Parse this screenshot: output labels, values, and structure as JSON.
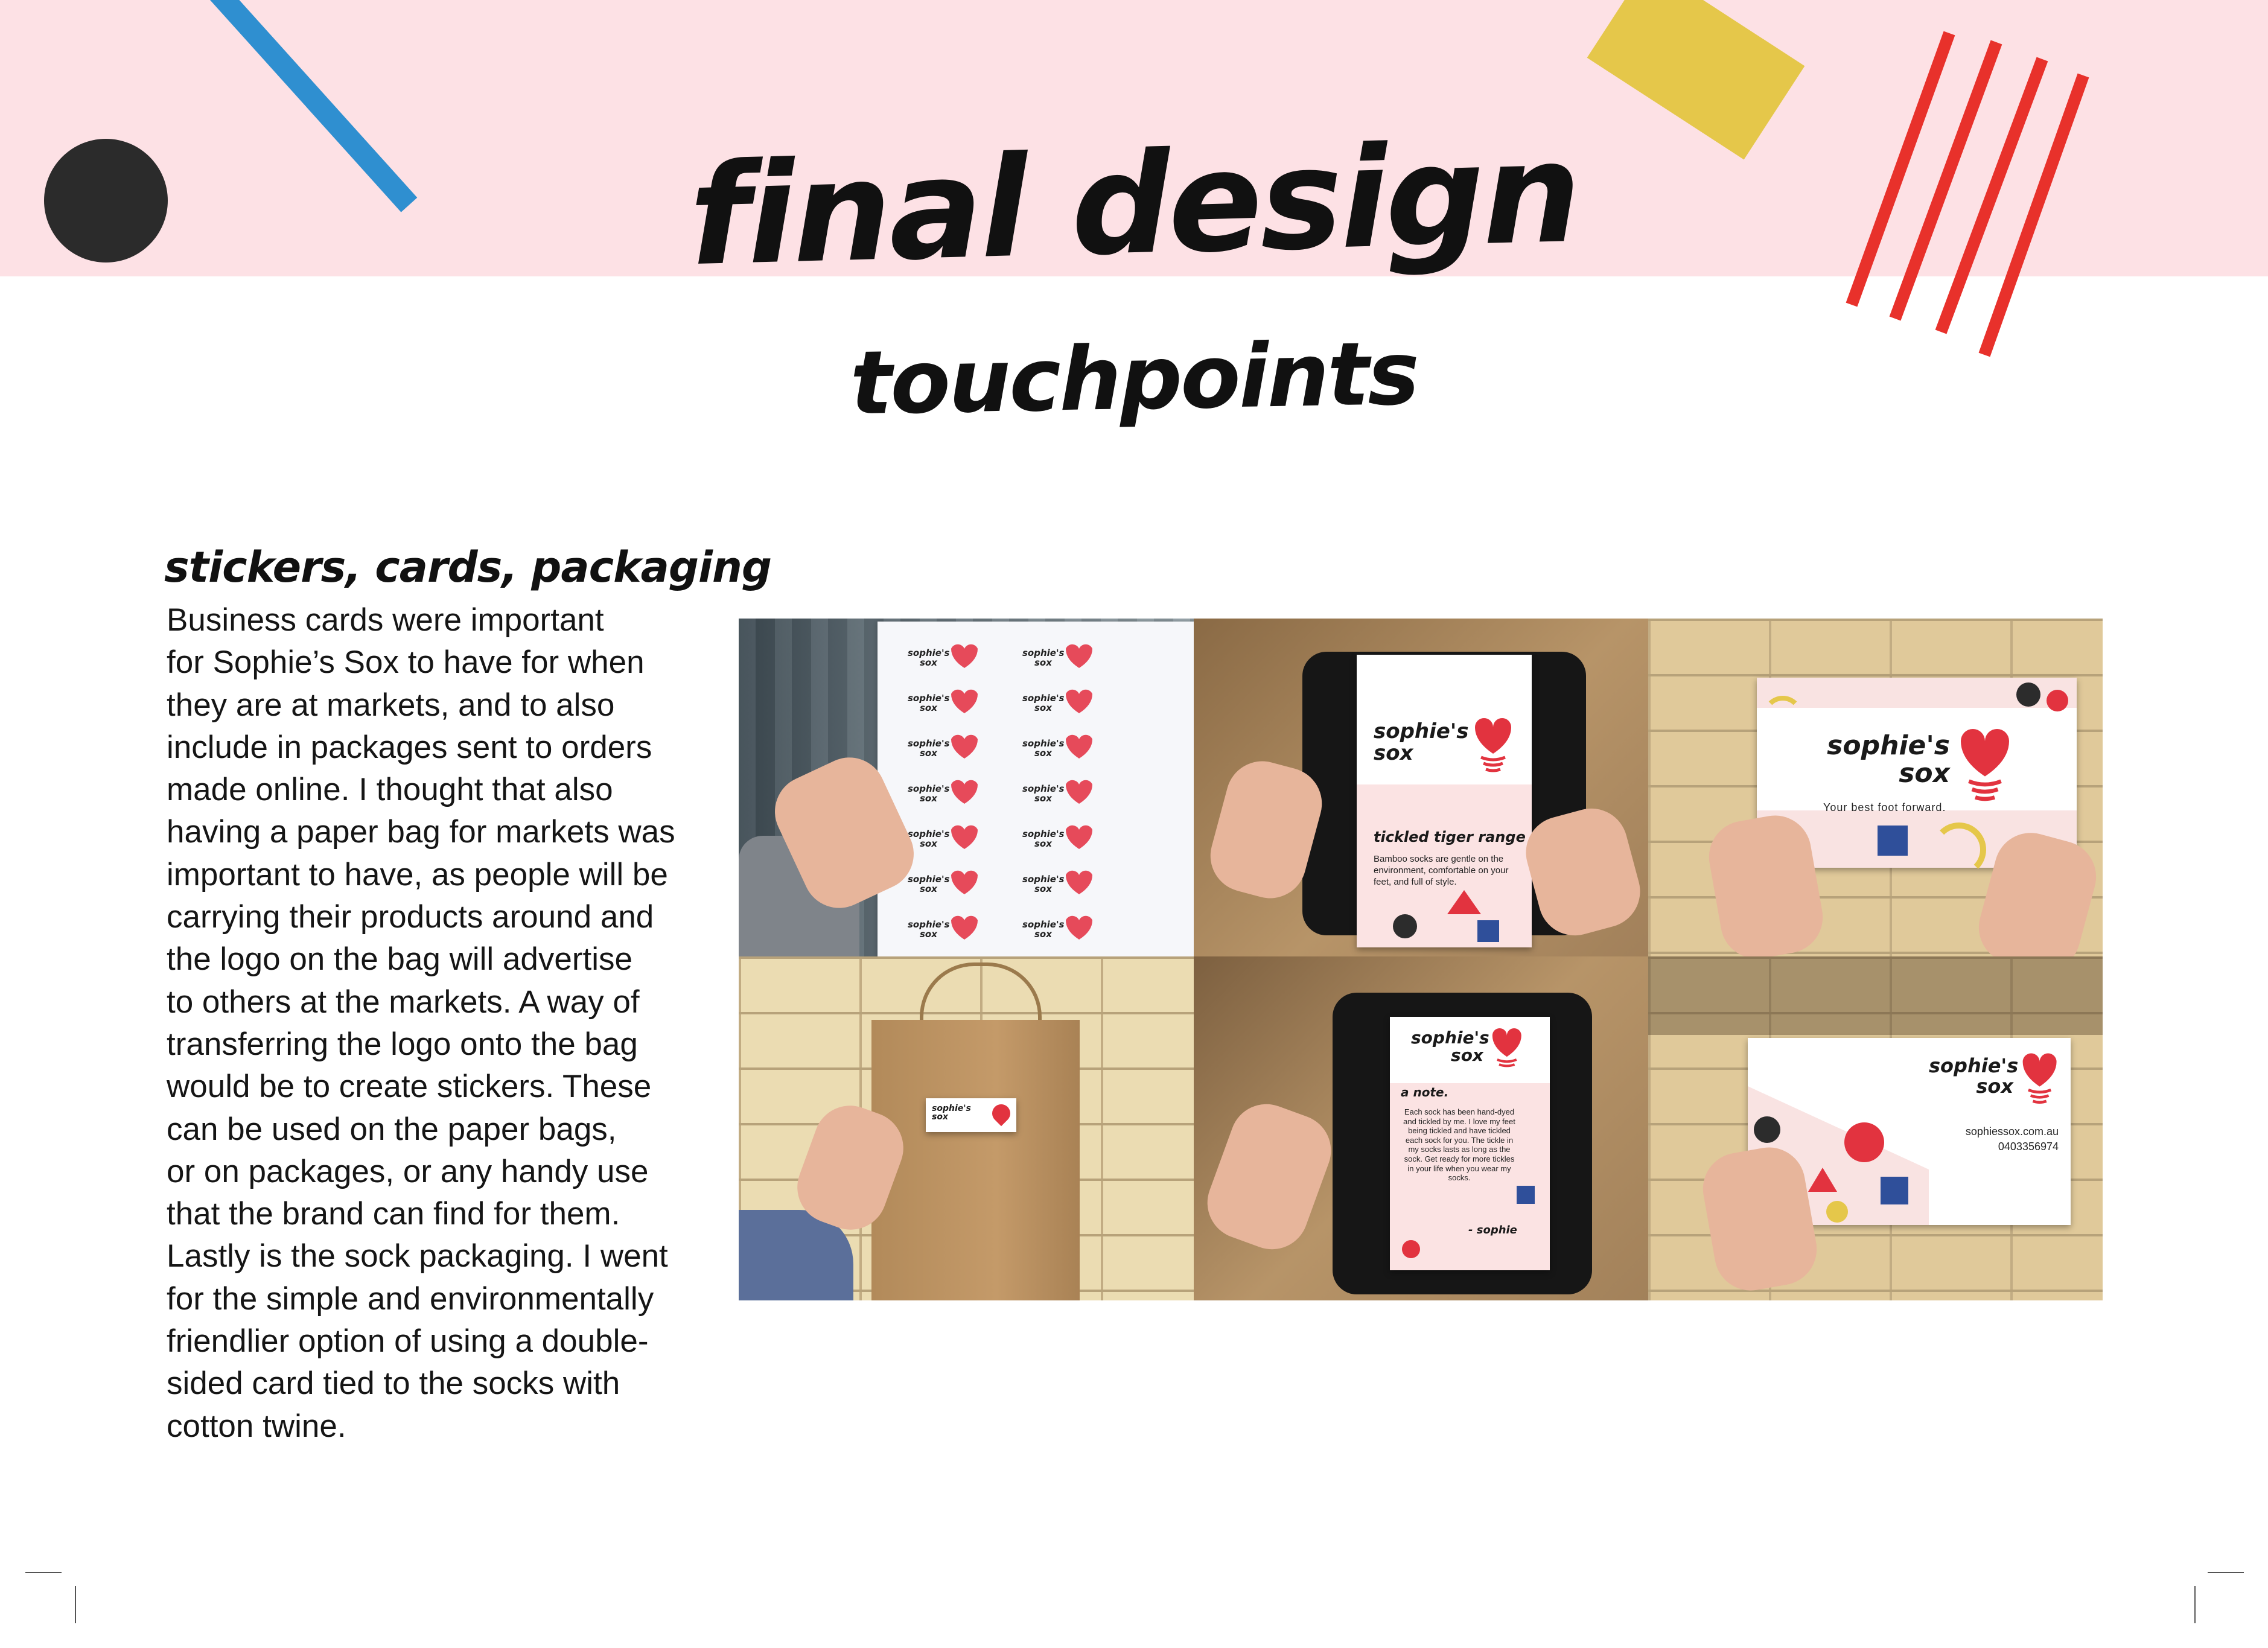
{
  "title": "final design",
  "subtitle": "touchpoints",
  "section": {
    "heading": "stickers, cards, packaging",
    "body": "Business cards were important\nfor Sophie’s Sox to have for when\nthey are at markets, and to also\ninclude in packages sent to orders\nmade online. I thought that also\nhaving a paper bag for markets was\nimportant to have, as people will be\ncarrying their products around and\nthe logo on the bag will advertise\nto others at the markets. A way of\ntransferring the logo onto the bag\nwould be to create stickers. These\ncan be used on the paper bags,\nor on packages, or any handy use\nthat the brand can find for them.\nLastly is the sock packaging. I went\nfor the simple and environmentally\nfriendlier option of using a double-\nsided card tied to the socks with\ncotton twine."
  },
  "photos": {
    "brand_name": "sophie's sox",
    "tagline": "Your best foot forward.",
    "range_title": "tickled tiger range",
    "range_text": "Bamboo socks are gentle on the environment, comfortable on your feet, and full of style.",
    "note_title": "a note.",
    "note_text": "Each sock has been hand-dyed and tickled by me. I love my feet being tickled and have tickled each sock for you. The tickle in my socks lasts as long as the sock. Get ready for more tickles in your life when you wear my socks.",
    "note_sign": "- sophie",
    "website": "sophiessox.com.au",
    "phone": "0403356974"
  },
  "colors": {
    "band": "#fde1e5",
    "blue": "#2f8fd0",
    "yellow": "#e5c74a",
    "red": "#e8312b",
    "dark": "#2b2b2b"
  }
}
